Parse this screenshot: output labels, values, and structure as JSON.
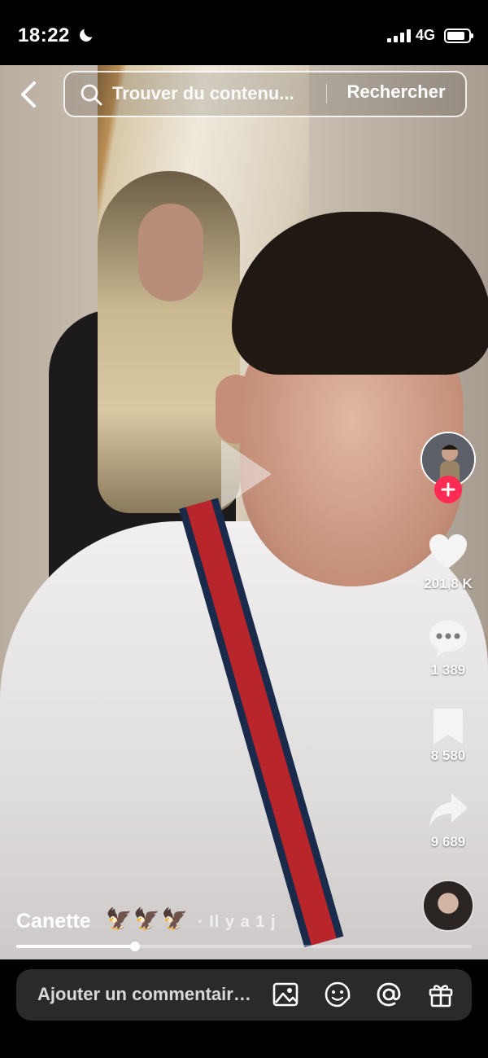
{
  "status_bar": {
    "time": "18:22",
    "network": "4G",
    "battery_level": 0.85
  },
  "search": {
    "placeholder": "Trouver du contenu...",
    "button_label": "Rechercher"
  },
  "rail": {
    "likes": "201,8 K",
    "comments": "1 389",
    "bookmarks": "8 580",
    "shares": "9 689"
  },
  "caption": {
    "author": "Canette",
    "emojis": "🦅🦅🦅",
    "time": "· Il y a 1 j"
  },
  "progress": 0.26,
  "comment": {
    "placeholder": "Ajouter un commentaire..."
  },
  "icons": [
    "moon-icon",
    "back-icon",
    "search-icon",
    "play-icon",
    "plus-icon",
    "heart-icon",
    "comment-icon",
    "bookmark-icon",
    "share-icon",
    "image-icon",
    "emoji-icon",
    "mention-icon",
    "gift-icon"
  ],
  "colors": {
    "accent": "#fe2c55",
    "comment_box": "#2a2a2c",
    "background": "#000000"
  }
}
